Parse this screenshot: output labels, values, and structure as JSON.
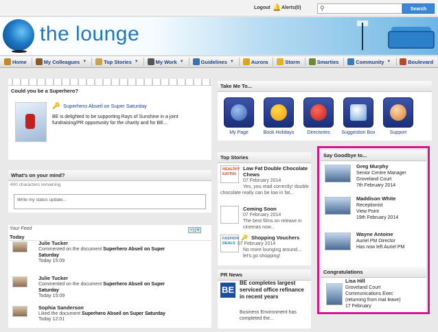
{
  "topbar": {
    "logout": "Logout",
    "alerts": "Alerts(0)",
    "search_placeholder": "",
    "search_button": "Search"
  },
  "brand": {
    "title": "the lounge"
  },
  "nav": [
    {
      "label": "Home",
      "icon": "home-icon",
      "dropdown": false,
      "color": "#c08a2a"
    },
    {
      "label": "My Colleagues",
      "icon": "colleagues-icon",
      "dropdown": true,
      "color": "#8a5b2a"
    },
    {
      "label": "Top Stories",
      "icon": "top-stories-icon",
      "dropdown": true,
      "color": "#c9a34a"
    },
    {
      "label": "My Work",
      "icon": "my-work-icon",
      "dropdown": true,
      "color": "#555555"
    },
    {
      "label": "Guidelines",
      "icon": "guidelines-icon",
      "dropdown": true,
      "color": "#3b6fb8"
    },
    {
      "label": "Aurora",
      "icon": "aurora-icon",
      "dropdown": false,
      "color": "#d9a421"
    },
    {
      "label": "Storm",
      "icon": "storm-icon",
      "dropdown": false,
      "color": "#e0b030"
    },
    {
      "label": "Smarties",
      "icon": "smarties-icon",
      "dropdown": false,
      "color": "#6a8a3a"
    },
    {
      "label": "Community",
      "icon": "community-icon",
      "dropdown": true,
      "color": "#3a7ab8"
    },
    {
      "label": "Boulevard",
      "icon": "boulevard-icon",
      "dropdown": false,
      "color": "#b84a2a"
    }
  ],
  "hero": {
    "title": "Could you be a Superhero?",
    "link": "Superhero Abseil on Super Saturday",
    "desc": "BE is delighted to be supporting Rays of Sunshine in a joint fundraising/PR opportunity for the charity and for BE..."
  },
  "mind": {
    "title": "What's on your mind?",
    "remaining": "400 characters remaining",
    "placeholder": "Write my status update..."
  },
  "feed": {
    "title": "Your Feed",
    "section": "Today",
    "items": [
      {
        "name": "Julie Tucker",
        "action": "Commented on the document ",
        "doc": "Superhero Abseil on Super Saturday",
        "time": "Today 15:09"
      },
      {
        "name": "Julie Tucker",
        "action": "Commented on the document ",
        "doc": "Superhero Abseil on Super Saturday",
        "time": "Today 15:09"
      },
      {
        "name": "Sophia Sanderson",
        "action": "Liked the document ",
        "doc": "Superhero Abseil on Super Saturday",
        "time": "Today 12:01"
      }
    ]
  },
  "takeme": {
    "title": "Take Me To...",
    "items": [
      {
        "label": "My Page",
        "icon": "my-page-icon"
      },
      {
        "label": "Book Holidays",
        "icon": "sun-icon"
      },
      {
        "label": "Directories",
        "icon": "phone-icon"
      },
      {
        "label": "Suggestion Box",
        "icon": "question-icon"
      },
      {
        "label": "Support",
        "icon": "support-icon"
      }
    ]
  },
  "topstories": {
    "title": "Top Stories",
    "items": [
      {
        "headline": "Low Fat Double Chocolate Chews",
        "date": "07 February 2014",
        "snippet": "Yes, you read correctly! double chocolate really can be low in fat..."
      },
      {
        "headline": "Coming Soon",
        "date": "07 February 2014",
        "snippet": "The best films on release in cinemas now..."
      },
      {
        "headline": "Shopping Vouchers",
        "date": "07 February 2014",
        "snippet": "No more lounging around... let's go shopping!"
      }
    ],
    "image_labels": [
      "HEALTHY EATING",
      "",
      "FASHION DEALS"
    ]
  },
  "prnews": {
    "title": "PR News",
    "logo": "BE",
    "headline": "BE completes largest serviced office refinance in recent years",
    "snippet": "Business Environment has completed the..."
  },
  "goodbye": {
    "title": "Say Goodbye to...",
    "items": [
      {
        "name": "Greg Murphy",
        "line1": "Senior Centre Manager",
        "line2": "Groveland Court",
        "line3": "7th February 2014"
      },
      {
        "name": "Maddison White",
        "line1": "Receptionist",
        "line2": "View Point",
        "line3": "19th February 2014"
      },
      {
        "name": "Wayne Antoine",
        "line1": "Auriel PM Director",
        "line2": "Has now left Auriel PM",
        "line3": ""
      }
    ]
  },
  "congrats": {
    "title": "Congratulations",
    "items": [
      {
        "name": "Lisa Hill",
        "line1": "Groveland Court",
        "line2": "Communications Exec",
        "line3": "(returning from mat leave)",
        "line4": "17 February"
      }
    ]
  },
  "colors": {
    "highlight": "#d9158b",
    "brand": "#1977c6",
    "search": "#3b86d8",
    "link": "#1b3d92"
  }
}
